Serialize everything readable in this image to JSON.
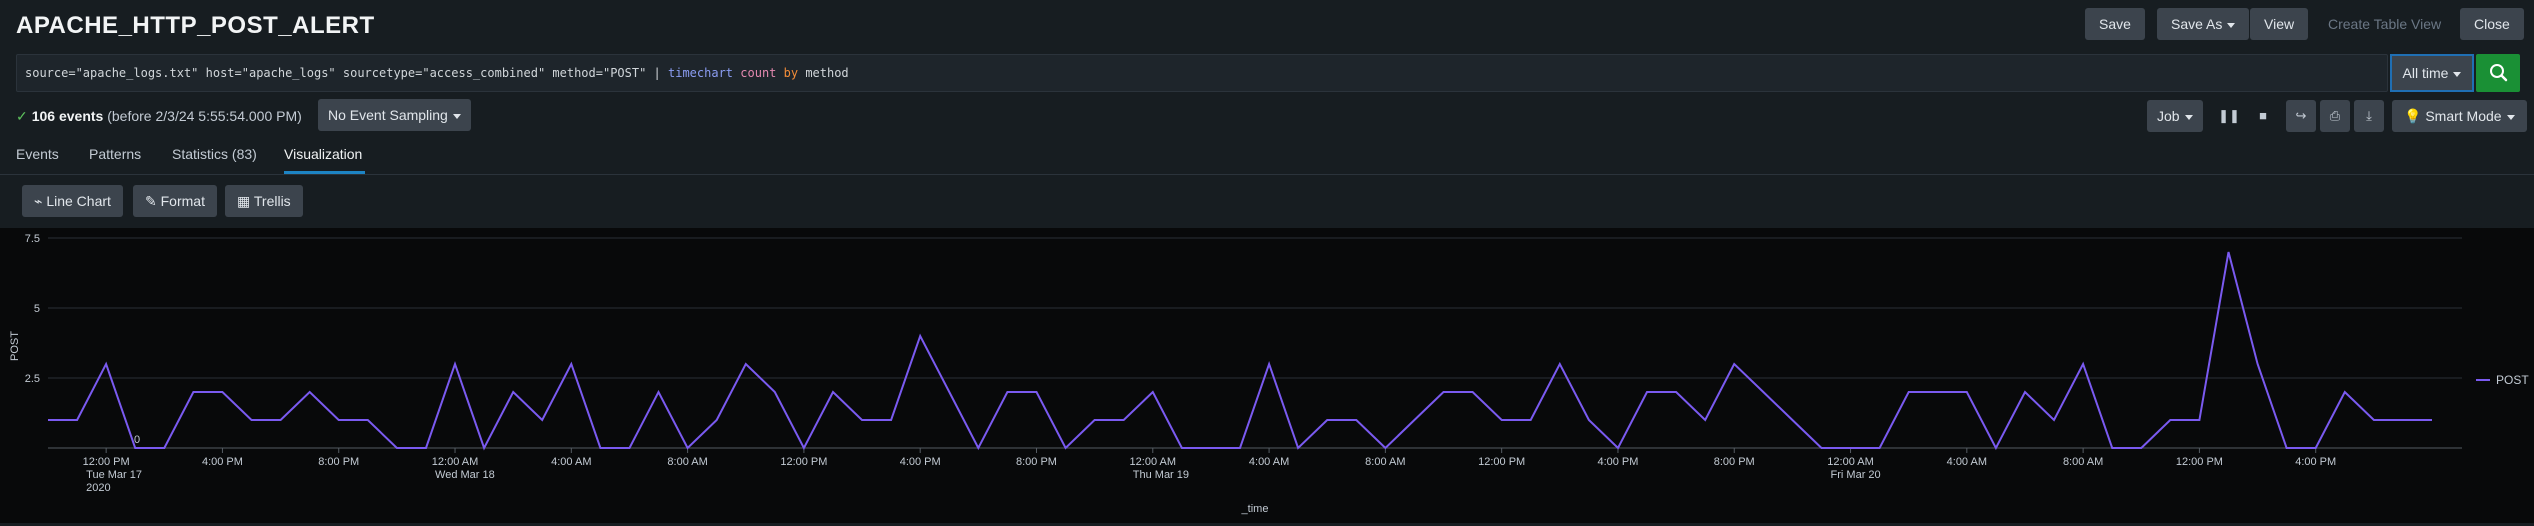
{
  "header": {
    "title": "APACHE_HTTP_POST_ALERT",
    "save": "Save",
    "save_as": "Save As",
    "view": "View",
    "create_table_view": "Create Table View",
    "close": "Close"
  },
  "search": {
    "query_plain": "source=\"apache_logs.txt\" host=\"apache_logs\" sourcetype=\"access_combined\" method=\"POST\" | ",
    "cmd": "timechart",
    "fn": "count",
    "op": "by",
    "field": "method",
    "time_range": "All time"
  },
  "status": {
    "count": "106 events",
    "detail": "(before 2/3/24 5:55:54.000 PM)",
    "sampling": "No Event Sampling",
    "job": "Job",
    "mode": "Smart Mode"
  },
  "tabs": [
    {
      "label": "Events"
    },
    {
      "label": "Patterns"
    },
    {
      "label": "Statistics (83)"
    },
    {
      "label": "Visualization"
    }
  ],
  "viz_toolbar": {
    "line_chart": "Line Chart",
    "format": "Format",
    "trellis": "Trellis"
  },
  "icons": {
    "share": "share-icon",
    "print": "print-icon",
    "export": "export-icon",
    "pause": "pause-icon",
    "stop": "stop-icon",
    "search": "search-icon"
  },
  "colors": {
    "series": "#7a5af0",
    "search_button": "#1a9035",
    "active_tab": "#1d84c4"
  },
  "chart_data": {
    "type": "line",
    "xlabel": "_time",
    "ylabel": "POST",
    "y_ticks": [
      "2.5",
      "5",
      "7.5"
    ],
    "ylim": [
      0,
      7.5
    ],
    "x_ticks": [
      {
        "label": "12:00 PM",
        "sub": "Tue Mar 17",
        "sub2": "2020",
        "idx": 2
      },
      {
        "label": "4:00 PM",
        "idx": 6
      },
      {
        "label": "8:00 PM",
        "idx": 10
      },
      {
        "label": "12:00 AM",
        "sub": "Wed Mar 18",
        "idx": 14
      },
      {
        "label": "4:00 AM",
        "idx": 18
      },
      {
        "label": "8:00 AM",
        "idx": 22
      },
      {
        "label": "12:00 PM",
        "idx": 26
      },
      {
        "label": "4:00 PM",
        "idx": 30
      },
      {
        "label": "8:00 PM",
        "idx": 34
      },
      {
        "label": "12:00 AM",
        "sub": "Thu Mar 19",
        "idx": 38
      },
      {
        "label": "4:00 AM",
        "idx": 42
      },
      {
        "label": "8:00 AM",
        "idx": 46
      },
      {
        "label": "12:00 PM",
        "idx": 50
      },
      {
        "label": "4:00 PM",
        "idx": 54
      },
      {
        "label": "8:00 PM",
        "idx": 58
      },
      {
        "label": "12:00 AM",
        "sub": "Fri Mar 20",
        "idx": 62
      },
      {
        "label": "4:00 AM",
        "idx": 66
      },
      {
        "label": "8:00 AM",
        "idx": 70
      },
      {
        "label": "12:00 PM",
        "idx": 74
      },
      {
        "label": "4:00 PM",
        "idx": 78
      }
    ],
    "legend": "POST",
    "legend_position": "right",
    "series": [
      {
        "name": "POST",
        "values": [
          1,
          1,
          3,
          0,
          0,
          2,
          2,
          1,
          1,
          2,
          1,
          1,
          0,
          0,
          3,
          0,
          2,
          1,
          3,
          0,
          0,
          2,
          0,
          1,
          3,
          2,
          0,
          2,
          1,
          1,
          4,
          2,
          0,
          2,
          2,
          0,
          1,
          1,
          2,
          0,
          0,
          0,
          3,
          0,
          1,
          1,
          0,
          1,
          2,
          2,
          1,
          1,
          3,
          1,
          0,
          2,
          2,
          1,
          3,
          2,
          1,
          0,
          0,
          0,
          2,
          2,
          2,
          0,
          2,
          1,
          3,
          0,
          0,
          1,
          1,
          7,
          3,
          0,
          0,
          2,
          1,
          1,
          1
        ]
      }
    ],
    "annotation": "0"
  }
}
